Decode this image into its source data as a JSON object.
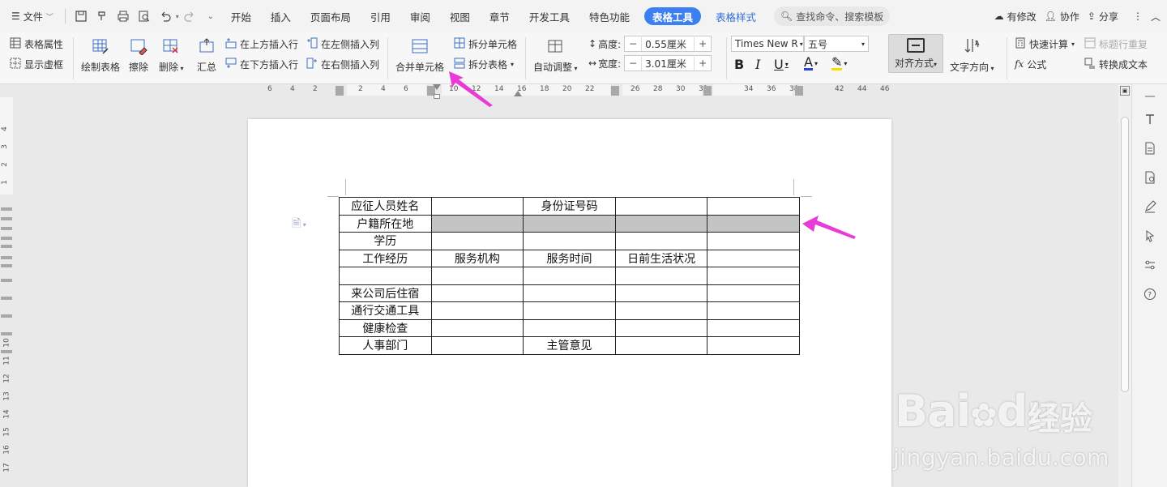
{
  "menubar": {
    "file_label": "文件",
    "tabs": [
      {
        "label": "开始"
      },
      {
        "label": "插入"
      },
      {
        "label": "页面布局"
      },
      {
        "label": "引用"
      },
      {
        "label": "审阅"
      },
      {
        "label": "视图"
      },
      {
        "label": "章节"
      },
      {
        "label": "开发工具"
      },
      {
        "label": "特色功能"
      }
    ],
    "active_tab": "表格工具",
    "context_tab": "表格样式",
    "search_placeholder": "查找命令、搜索模板",
    "right": {
      "modified": "有修改",
      "collab": "协作",
      "share": "分享"
    }
  },
  "ribbon": {
    "table_props": "表格属性",
    "show_grid": "显示虚框",
    "draw_table": "绘制表格",
    "erase": "擦除",
    "delete": "删除",
    "summary": "汇总",
    "insert_above": "在上方插入行",
    "insert_below": "在下方插入行",
    "insert_left": "在左侧插入列",
    "insert_right": "在右侧插入列",
    "merge_cells": "合并单元格",
    "split_cells": "拆分单元格",
    "split_table": "拆分表格",
    "auto_fit": "自动调整",
    "height_label": "高度:",
    "height_value": "0.55厘米",
    "width_label": "宽度:",
    "width_value": "3.01厘米",
    "font_name": "Times New R",
    "font_size": "五号",
    "align": "对齐方式",
    "text_dir": "文字方向",
    "quick_calc": "快速计算",
    "repeat_header": "标题行重复",
    "formula": "公式",
    "to_text": "转换成文本"
  },
  "ruler": {
    "h_numbers": [
      "6",
      "4",
      "2",
      "",
      "2",
      "4",
      "6",
      "",
      "10",
      "12",
      "14",
      "16",
      "18",
      "20",
      "22",
      "",
      "26",
      "28",
      "30",
      "32",
      "",
      "34",
      "36",
      "38",
      "",
      "42",
      "44",
      "46"
    ],
    "v_numbers": [
      "4",
      "3",
      "2",
      "1",
      "",
      "",
      "",
      "",
      "",
      "",
      "",
      "",
      "10",
      "11",
      "12",
      "13",
      "14",
      "15",
      "16",
      "17"
    ]
  },
  "document": {
    "table": [
      [
        "应征人员姓名",
        "",
        "身份证号码",
        "",
        ""
      ],
      [
        "户籍所在地",
        "",
        "",
        "",
        ""
      ],
      [
        "学历",
        "",
        "",
        "",
        ""
      ],
      [
        "工作经历",
        "服务机构",
        "服务时间",
        "日前生活状况",
        ""
      ],
      [
        "",
        "",
        "",
        "",
        ""
      ],
      [
        "来公司后住宿",
        "",
        "",
        "",
        ""
      ],
      [
        "通行交通工具",
        "",
        "",
        "",
        ""
      ],
      [
        "健康检查",
        "",
        "",
        "",
        ""
      ],
      [
        "人事部门",
        "",
        "主管意见",
        "",
        ""
      ]
    ],
    "selected_row": 1,
    "selected_cols": [
      1,
      2,
      3,
      4
    ]
  },
  "watermark": {
    "brand": "Bai",
    "brand2": "du",
    "brand_cn": "经验",
    "url": "jingyan.baidu.com"
  },
  "colors": {
    "accent": "#3b7ff0",
    "arrow": "#e83ad6",
    "selection": "#c4c4c4"
  }
}
